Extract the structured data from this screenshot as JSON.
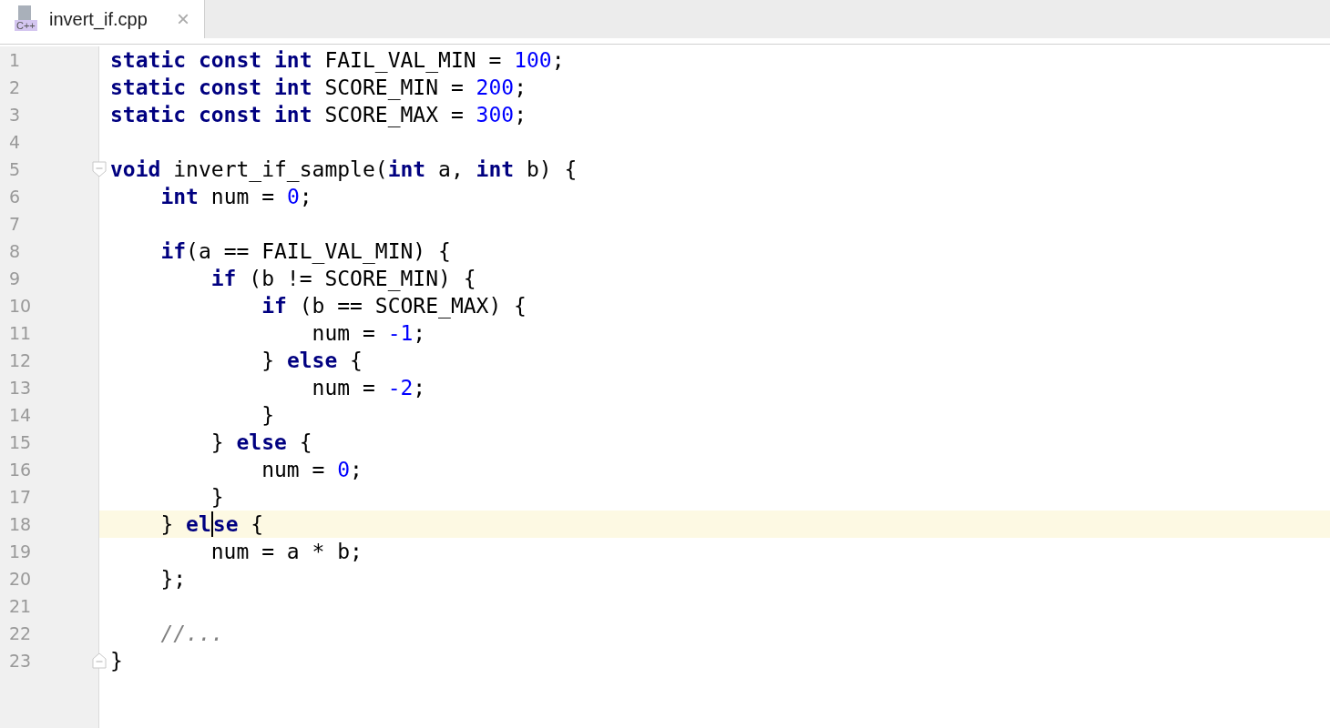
{
  "tabs": [
    {
      "label": "invert_if.cpp",
      "icon_text": "C++",
      "close": "×",
      "selected": true
    }
  ],
  "lines": [
    {
      "number": "1",
      "tokens": [
        {
          "kind": "keyword",
          "text": "static const int"
        },
        {
          "kind": "plain",
          "text": " FAIL_VAL_MIN = "
        },
        {
          "kind": "number",
          "text": "100"
        },
        {
          "kind": "plain",
          "text": ";"
        }
      ]
    },
    {
      "number": "2",
      "tokens": [
        {
          "kind": "keyword",
          "text": "static const int"
        },
        {
          "kind": "plain",
          "text": " SCORE_MIN = "
        },
        {
          "kind": "number",
          "text": "200"
        },
        {
          "kind": "plain",
          "text": ";"
        }
      ]
    },
    {
      "number": "3",
      "tokens": [
        {
          "kind": "keyword",
          "text": "static const int"
        },
        {
          "kind": "plain",
          "text": " SCORE_MAX = "
        },
        {
          "kind": "number",
          "text": "300"
        },
        {
          "kind": "plain",
          "text": ";"
        }
      ]
    },
    {
      "number": "4"
    },
    {
      "number": "5",
      "fold_start": true,
      "tokens": [
        {
          "kind": "keyword",
          "text": "void"
        },
        {
          "kind": "plain",
          "text": " invert_if_sample("
        },
        {
          "kind": "keyword",
          "text": "int"
        },
        {
          "kind": "plain",
          "text": " a, "
        },
        {
          "kind": "keyword",
          "text": "int"
        },
        {
          "kind": "plain",
          "text": " b) {"
        }
      ]
    },
    {
      "number": "6",
      "tokens": [
        {
          "kind": "keyword",
          "text": "    int"
        },
        {
          "kind": "plain",
          "text": " num = "
        },
        {
          "kind": "number",
          "text": "0"
        },
        {
          "kind": "plain",
          "text": ";"
        }
      ]
    },
    {
      "number": "7"
    },
    {
      "number": "8",
      "tokens": [
        {
          "kind": "keyword",
          "text": "    if"
        },
        {
          "kind": "plain",
          "text": "(a == FAIL_VAL_MIN) {"
        }
      ]
    },
    {
      "number": "9",
      "tokens": [
        {
          "kind": "keyword",
          "text": "        if"
        },
        {
          "kind": "plain",
          "text": " (b != SCORE_MIN) {"
        }
      ]
    },
    {
      "number": "10",
      "tokens": [
        {
          "kind": "keyword",
          "text": "            if"
        },
        {
          "kind": "plain",
          "text": " (b == SCORE_MAX) {"
        }
      ]
    },
    {
      "number": "11",
      "tokens": [
        {
          "kind": "plain",
          "text": "                num = "
        },
        {
          "kind": "number",
          "text": "-1"
        },
        {
          "kind": "plain",
          "text": ";"
        }
      ]
    },
    {
      "number": "12",
      "tokens": [
        {
          "kind": "plain",
          "text": "            } "
        },
        {
          "kind": "keyword",
          "text": "else"
        },
        {
          "kind": "plain",
          "text": " {"
        }
      ]
    },
    {
      "number": "13",
      "tokens": [
        {
          "kind": "plain",
          "text": "                num = "
        },
        {
          "kind": "number",
          "text": "-2"
        },
        {
          "kind": "plain",
          "text": ";"
        }
      ]
    },
    {
      "number": "14",
      "tokens": [
        {
          "kind": "plain",
          "text": "            }"
        }
      ]
    },
    {
      "number": "15",
      "tokens": [
        {
          "kind": "plain",
          "text": "        } "
        },
        {
          "kind": "keyword",
          "text": "else"
        },
        {
          "kind": "plain",
          "text": " {"
        }
      ]
    },
    {
      "number": "16",
      "tokens": [
        {
          "kind": "plain",
          "text": "            num = "
        },
        {
          "kind": "number",
          "text": "0"
        },
        {
          "kind": "plain",
          "text": ";"
        }
      ]
    },
    {
      "number": "17",
      "tokens": [
        {
          "kind": "plain",
          "text": "        }"
        }
      ]
    },
    {
      "number": "18",
      "current": true,
      "tokens": [
        {
          "kind": "plain",
          "text": "    } "
        },
        {
          "kind": "keyword",
          "text": "el"
        },
        {
          "kind": "keyword",
          "text": "se",
          "caret": true
        },
        {
          "kind": "plain",
          "text": " {"
        }
      ]
    },
    {
      "number": "19",
      "tokens": [
        {
          "kind": "plain",
          "text": "        num = a * b;"
        }
      ]
    },
    {
      "number": "20",
      "tokens": [
        {
          "kind": "plain",
          "text": "    };"
        }
      ]
    },
    {
      "number": "21"
    },
    {
      "number": "22",
      "tokens": [
        {
          "kind": "comment",
          "text": "    //..."
        }
      ]
    },
    {
      "number": "23",
      "fold_end": true,
      "tokens": [
        {
          "kind": "plain",
          "text": "}"
        }
      ]
    }
  ]
}
